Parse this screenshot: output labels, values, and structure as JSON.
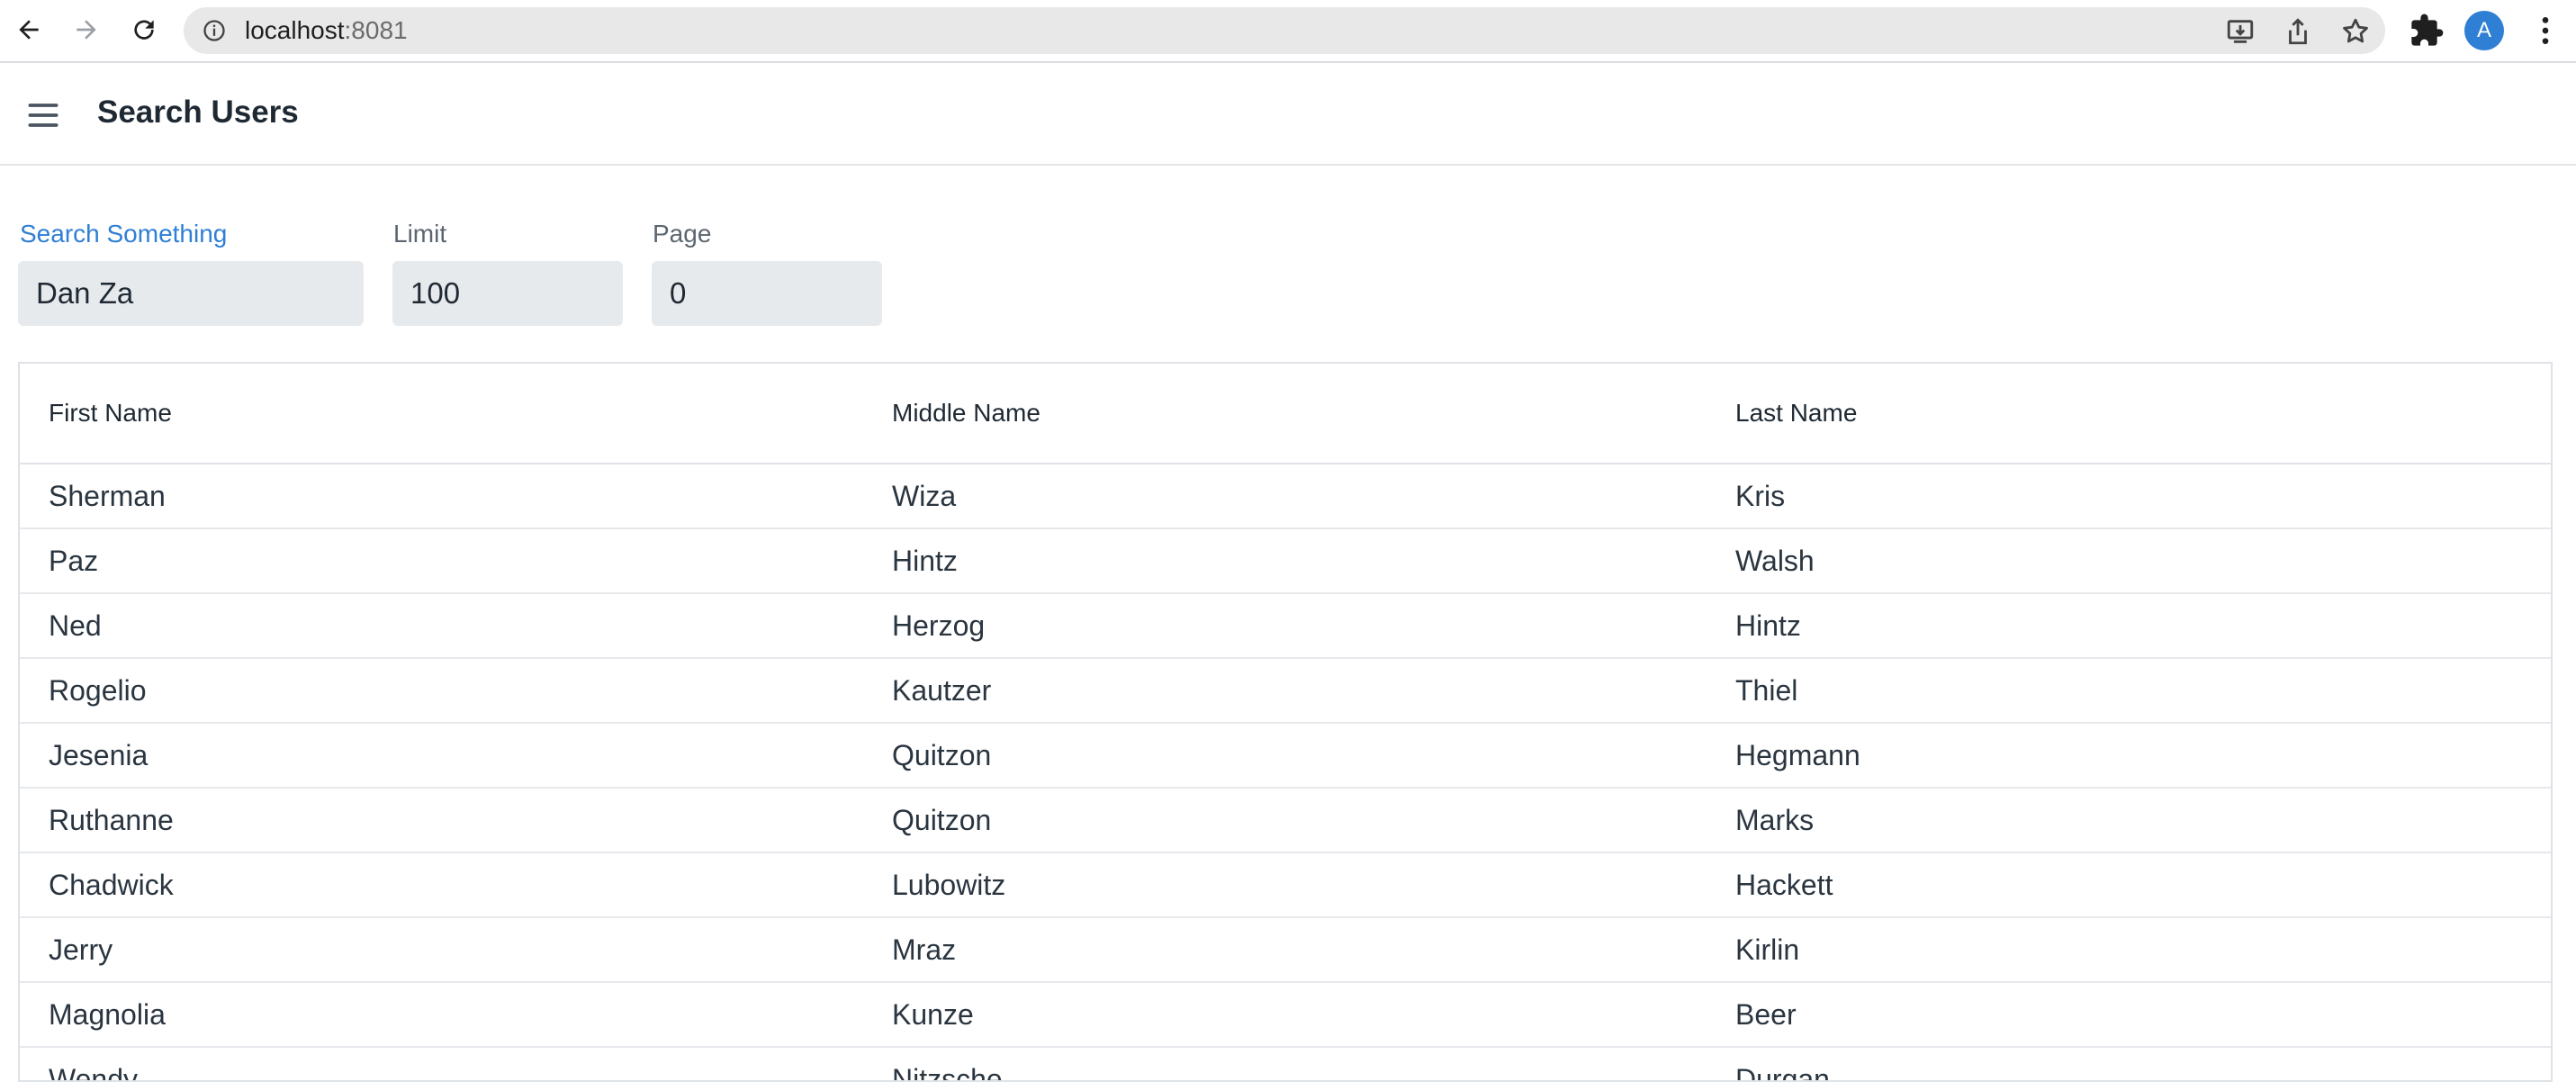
{
  "browser": {
    "url_host": "localhost",
    "url_port": ":8081",
    "avatar_letter": "A",
    "icons": [
      "back-arrow-icon",
      "forward-arrow-icon",
      "reload-icon",
      "info-icon",
      "install-icon",
      "share-icon",
      "star-icon",
      "extensions-icon",
      "kebab-menu-icon"
    ]
  },
  "header": {
    "title": "Search Users",
    "menu_icon": "hamburger-icon"
  },
  "form": {
    "search": {
      "label": "Search Something",
      "value": "Dan Za"
    },
    "limit": {
      "label": "Limit",
      "value": "100"
    },
    "page": {
      "label": "Page",
      "value": "0"
    }
  },
  "table": {
    "columns": [
      "First Name",
      "Middle Name",
      "Last Name"
    ],
    "rows": [
      [
        "Sherman",
        "Wiza",
        "Kris"
      ],
      [
        "Paz",
        "Hintz",
        "Walsh"
      ],
      [
        "Ned",
        "Herzog",
        "Hintz"
      ],
      [
        "Rogelio",
        "Kautzer",
        "Thiel"
      ],
      [
        "Jesenia",
        "Quitzon",
        "Hegmann"
      ],
      [
        "Ruthanne",
        "Quitzon",
        "Marks"
      ],
      [
        "Chadwick",
        "Lubowitz",
        "Hackett"
      ],
      [
        "Jerry",
        "Mraz",
        "Kirlin"
      ],
      [
        "Magnolia",
        "Kunze",
        "Beer"
      ],
      [
        "Wendy",
        "Nitzsche",
        "Durgan"
      ]
    ]
  },
  "colors": {
    "accent": "#2f7fd4",
    "input_bg": "#e7eaed",
    "border": "#dfe2e6"
  }
}
